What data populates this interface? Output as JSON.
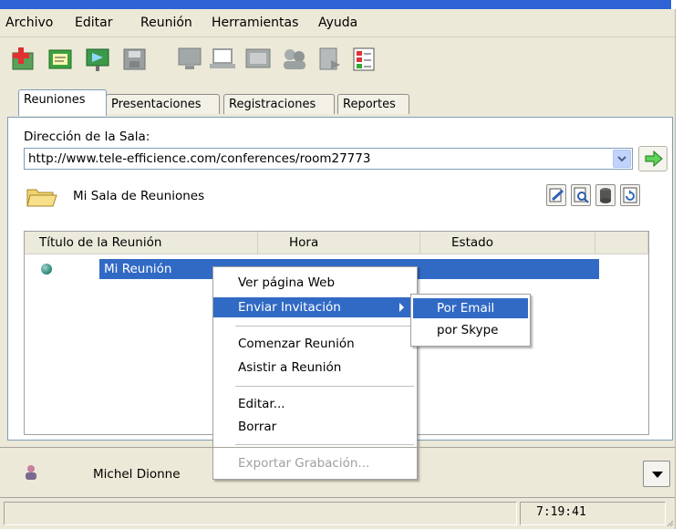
{
  "menu": {
    "items": [
      "Archivo",
      "Editar",
      "Reunión",
      "Herramientas",
      "Ayuda"
    ]
  },
  "toolbar": {
    "icons": [
      "new-meeting-icon",
      "folder-card-icon",
      "presentation-icon",
      "save-disk-icon",
      "monitor-icon",
      "laptop-icon",
      "projector-icon",
      "group-icon",
      "document-icon",
      "checklist-icon"
    ]
  },
  "tabs": [
    "Reuniones",
    "Presentaciones",
    "Registraciones",
    "Reportes"
  ],
  "room": {
    "address_label": "Dirección de la Sala:",
    "address_value": "http://www.tele-efficience.com/conferences/room27773",
    "folder_title": "Mi Sala de Reuniones"
  },
  "table": {
    "columns": [
      "Título de la Reunión",
      "Hora",
      "Estado"
    ],
    "rows": [
      {
        "title": "Mi Reunión",
        "hora": "",
        "estado": ""
      }
    ]
  },
  "context_menu": {
    "items": [
      "Ver página Web",
      "Enviar Invitación",
      "Comenzar Reunión",
      "Asistir a Reunión",
      "Editar...",
      "Borrar",
      "Exportar Grabación..."
    ],
    "submenu": [
      "Por Email",
      "por Skype"
    ]
  },
  "user": {
    "name": "Michel Dionne"
  },
  "status": {
    "time": "7:19:41"
  },
  "colors": {
    "selection": "#316ac5",
    "face": "#ece9d8",
    "border": "#7f9db9"
  }
}
